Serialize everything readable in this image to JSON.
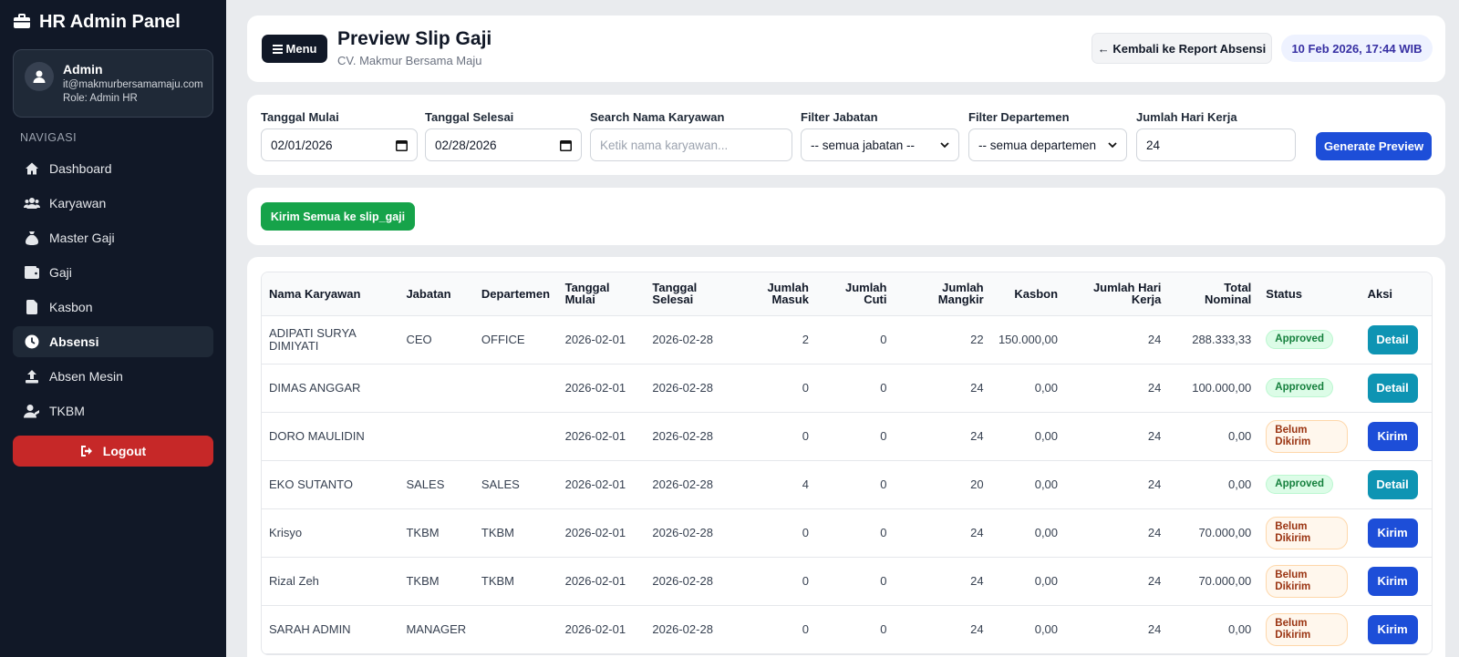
{
  "app": {
    "title": "HR Admin Panel"
  },
  "user": {
    "name": "Admin",
    "email": "it@makmurbersamamaju.com",
    "role": "Role: Admin HR"
  },
  "nav": {
    "title": "NAVIGASI",
    "items": [
      {
        "label": "Dashboard",
        "icon": "home-icon"
      },
      {
        "label": "Karyawan",
        "icon": "users-icon"
      },
      {
        "label": "Master Gaji",
        "icon": "money-bag-icon"
      },
      {
        "label": "Gaji",
        "icon": "wallet-icon"
      },
      {
        "label": "Kasbon",
        "icon": "file-icon"
      },
      {
        "label": "Absensi",
        "icon": "clock-icon",
        "active": true
      },
      {
        "label": "Absen Mesin",
        "icon": "upload-icon"
      },
      {
        "label": "TKBM",
        "icon": "user-tie-icon"
      }
    ],
    "logout": "Logout"
  },
  "header": {
    "menu_label": "Menu",
    "title": "Preview Slip Gaji",
    "subtitle": "CV. Makmur Bersama Maju",
    "back_label": "← Kembali ke Report Absensi",
    "datetime": "10 Feb 2026, 17:44 WIB"
  },
  "filters": {
    "start_label": "Tanggal Mulai",
    "start_value": "02/01/2026",
    "end_label": "Tanggal Selesai",
    "end_value": "02/28/2026",
    "search_label": "Search Nama Karyawan",
    "search_placeholder": "Ketik nama karyawan...",
    "jabatan_label": "Filter Jabatan",
    "jabatan_value": "-- semua jabatan --",
    "dept_label": "Filter Departemen",
    "dept_value": "-- semua departemen --",
    "hari_label": "Jumlah Hari Kerja",
    "hari_value": "24",
    "generate_label": "Generate Preview"
  },
  "actions": {
    "send_all_label": "Kirim Semua ke slip_gaji"
  },
  "table": {
    "headers": [
      "Nama Karyawan",
      "Jabatan",
      "Departemen",
      "Tanggal Mulai",
      "Tanggal Selesai",
      "Jumlah Masuk",
      "Jumlah Cuti",
      "Jumlah Mangkir",
      "Kasbon",
      "Jumlah Hari Kerja",
      "Total Nominal",
      "Status",
      "Aksi"
    ],
    "rows": [
      {
        "nama": "ADIPATI SURYA DIMIYATI",
        "jabatan": "CEO",
        "dept": "OFFICE",
        "mulai": "2026-02-01",
        "selesai": "2026-02-28",
        "masuk": "2",
        "cuti": "0",
        "mangkir": "22",
        "kasbon": "150.000,00",
        "hari": "24",
        "total": "288.333,33",
        "status": "Approved",
        "status_type": "ok",
        "aksi": "Detail"
      },
      {
        "nama": "DIMAS ANGGAR",
        "jabatan": "",
        "dept": "",
        "mulai": "2026-02-01",
        "selesai": "2026-02-28",
        "masuk": "0",
        "cuti": "0",
        "mangkir": "24",
        "kasbon": "0,00",
        "hari": "24",
        "total": "100.000,00",
        "status": "Approved",
        "status_type": "ok",
        "aksi": "Detail"
      },
      {
        "nama": "DORO MAULIDIN",
        "jabatan": "",
        "dept": "",
        "mulai": "2026-02-01",
        "selesai": "2026-02-28",
        "masuk": "0",
        "cuti": "0",
        "mangkir": "24",
        "kasbon": "0,00",
        "hari": "24",
        "total": "0,00",
        "status": "Belum Dikirim",
        "status_type": "pending",
        "aksi": "Kirim"
      },
      {
        "nama": "EKO SUTANTO",
        "jabatan": "SALES",
        "dept": "SALES",
        "mulai": "2026-02-01",
        "selesai": "2026-02-28",
        "masuk": "4",
        "cuti": "0",
        "mangkir": "20",
        "kasbon": "0,00",
        "hari": "24",
        "total": "0,00",
        "status": "Approved",
        "status_type": "ok",
        "aksi": "Detail"
      },
      {
        "nama": "Krisyo",
        "jabatan": "TKBM",
        "dept": "TKBM",
        "mulai": "2026-02-01",
        "selesai": "2026-02-28",
        "masuk": "0",
        "cuti": "0",
        "mangkir": "24",
        "kasbon": "0,00",
        "hari": "24",
        "total": "70.000,00",
        "status": "Belum Dikirim",
        "status_type": "pending",
        "aksi": "Kirim"
      },
      {
        "nama": "Rizal Zeh",
        "jabatan": "TKBM",
        "dept": "TKBM",
        "mulai": "2026-02-01",
        "selesai": "2026-02-28",
        "masuk": "0",
        "cuti": "0",
        "mangkir": "24",
        "kasbon": "0,00",
        "hari": "24",
        "total": "70.000,00",
        "status": "Belum Dikirim",
        "status_type": "pending",
        "aksi": "Kirim"
      },
      {
        "nama": "SARAH ADMIN",
        "jabatan": "MANAGER",
        "dept": "",
        "mulai": "2026-02-01",
        "selesai": "2026-02-28",
        "masuk": "0",
        "cuti": "0",
        "mangkir": "24",
        "kasbon": "0,00",
        "hari": "24",
        "total": "0,00",
        "status": "Belum Dikirim",
        "status_type": "pending",
        "aksi": "Kirim"
      }
    ]
  },
  "colors": {
    "sidebar_bg": "#111827",
    "primary": "#1d4ed8",
    "success": "#16a34a",
    "danger": "#c62828",
    "detail": "#0e94b3"
  }
}
